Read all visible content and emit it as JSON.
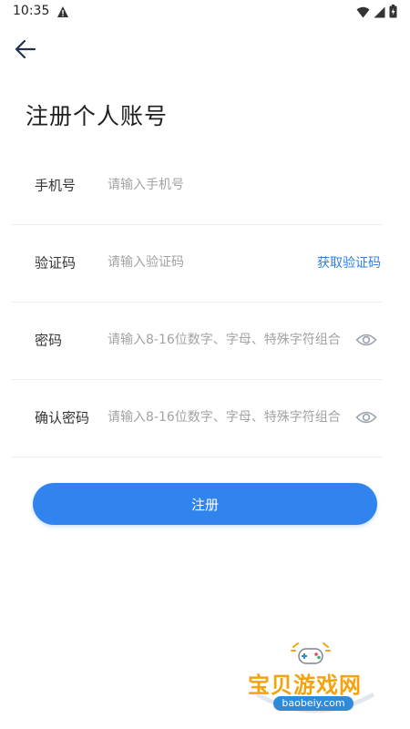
{
  "status_bar": {
    "time": "10:35",
    "icons": [
      "alert-icon",
      "wifi-icon",
      "signal-icon",
      "battery-icon"
    ]
  },
  "nav": {
    "back_icon": "arrow-left-icon"
  },
  "title": "注册个人账号",
  "form": {
    "phone": {
      "label": "手机号",
      "placeholder": "请输入手机号"
    },
    "code": {
      "label": "验证码",
      "placeholder": "请输入验证码",
      "action": "获取验证码"
    },
    "password": {
      "label": "密码",
      "placeholder": "请输入8-16位数字、字母、特殊字符组合"
    },
    "confirm_password": {
      "label": "确认密码",
      "placeholder": "请输入8-16位数字、字母、特殊字符组合"
    }
  },
  "submit_label": "注册",
  "watermark": {
    "title": "宝贝游戏网",
    "url": "baobeiy.com"
  },
  "colors": {
    "accent": "#3184ee",
    "link": "#2d7fe6",
    "placeholder": "#a3a3a3",
    "watermark": "#f5a30c"
  }
}
